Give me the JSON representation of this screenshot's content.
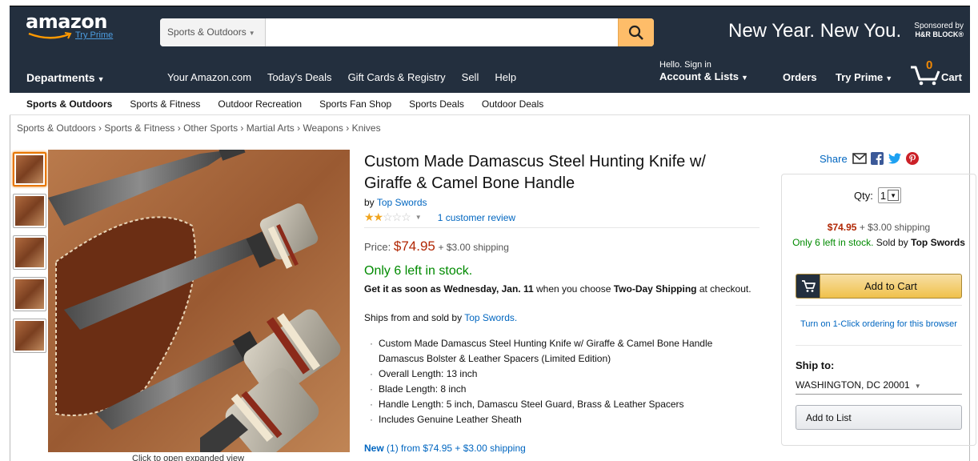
{
  "header": {
    "logo_text": "amazon",
    "logo_prime": "Try Prime",
    "search_category": "Sports & Outdoors",
    "search_placeholder": "",
    "promo": "New Year. New You.",
    "sponsor_line1": "Sponsored by",
    "sponsor_line2": "H&R BLOCK®"
  },
  "nav": {
    "departments": "Departments",
    "links": [
      "Your Amazon.com",
      "Today's Deals",
      "Gift Cards & Registry",
      "Sell",
      "Help"
    ],
    "hello": "Hello. Sign in",
    "account": "Account & Lists",
    "orders": "Orders",
    "try_prime": "Try Prime",
    "cart_count": "0",
    "cart": "Cart"
  },
  "subnav": [
    "Sports & Outdoors",
    "Sports & Fitness",
    "Outdoor Recreation",
    "Sports Fan Shop",
    "Sports Deals",
    "Outdoor Deals"
  ],
  "breadcrumb": "Sports & Outdoors › Sports & Fitness › Other Sports › Martial Arts › Weapons › Knives",
  "gallery": {
    "caption": "Click to open expanded view"
  },
  "product": {
    "title": "Custom Made Damascus Steel Hunting Knife w/ Giraffe & Camel Bone Handle",
    "by": "by",
    "brand": "Top Swords",
    "rating_stars": 2,
    "rating_max": 5,
    "reviews": "1 customer review",
    "price_label": "Price:",
    "price": "$74.95",
    "shipping": "+ $3.00 shipping",
    "stock": "Only 6 left in stock.",
    "delivery_pre": "Get it as soon as Wednesday, Jan. 11",
    "delivery_mid": " when you choose ",
    "delivery_method": "Two-Day Shipping",
    "delivery_post": " at checkout.",
    "ships_from_pre": "Ships from and sold by ",
    "ships_from_seller": "Top Swords.",
    "bullets": [
      "Custom Made Damascus Steel Hunting Knife w/ Giraffe & Camel Bone Handle Damascus Bolster & Leather Spacers (Limited Edition)",
      "Overall Length: 13 inch",
      "Blade Length: 8 inch",
      "Handle Length: 5 inch, Damascu Steel Guard, Brass & Leather Spacers",
      "Includes Genuine Leather Sheath"
    ],
    "new_offer_link": "New",
    "new_offer_count": " (1) from ",
    "new_offer_price": "$74.95 + $3.00 shipping"
  },
  "share": {
    "label": "Share"
  },
  "buybox": {
    "qty_label": "Qty:",
    "qty_value": "1",
    "price": "$74.95",
    "shipping": "+ $3.00 shipping",
    "stock": "Only 6 left in stock.",
    "sold_by_pre": " Sold by ",
    "sold_by": "Top Swords",
    "add_to_cart": "Add to Cart",
    "one_click": "Turn on 1-Click ordering for this browser",
    "ship_to_label": "Ship to:",
    "ship_to_addr": "WASHINGTON, DC 20001",
    "add_to_list": "Add to List"
  },
  "colors": {
    "nav_bg": "#232f3e",
    "price": "#b12704",
    "stock": "#008a00",
    "link": "#0066c0",
    "cart_button": "#f0c14b"
  }
}
